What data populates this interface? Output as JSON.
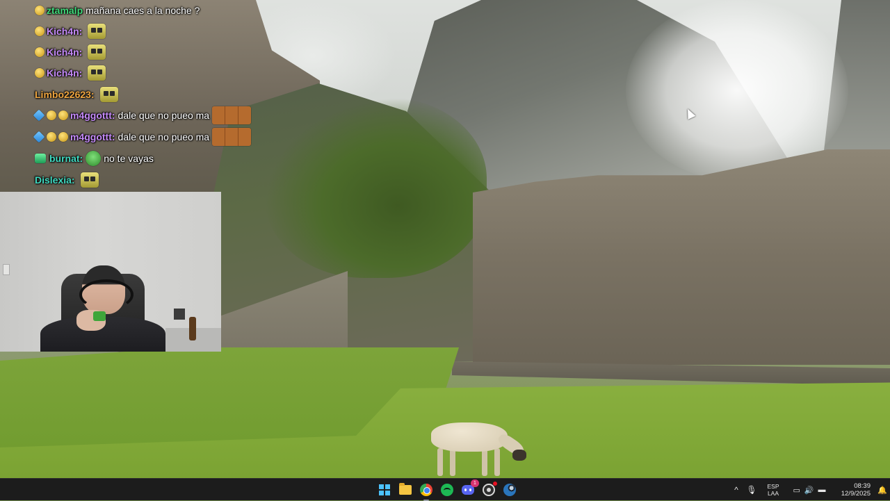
{
  "chat": {
    "messages": [
      {
        "user": "ztamalp",
        "text": "mañana caes a la noche ?",
        "user_color": "#3fd97a"
      },
      {
        "user": "Kich4n:",
        "text": "",
        "user_color": "#c58af9"
      },
      {
        "user": "Kich4n:",
        "text": "",
        "user_color": "#c58af9"
      },
      {
        "user": "Kich4n:",
        "text": "",
        "user_color": "#c58af9"
      },
      {
        "user": "Limbo22623:",
        "text": "",
        "user_color": "#f0a640"
      },
      {
        "user": "m4ggottt:",
        "text": "dale que no pueo ma",
        "user_color": "#c58af9"
      },
      {
        "user": "m4ggottt:",
        "text": "dale que no pueo ma",
        "user_color": "#c58af9"
      },
      {
        "user": "burnat:",
        "text": "no te vayas",
        "user_color": "#3fd9c0"
      },
      {
        "user": "Dislexia:",
        "text": "",
        "user_color": "#3fd9c0"
      }
    ]
  },
  "icons": {
    "badge": "sub-badge-icon",
    "emote": "emote-icon",
    "cursor": "mouse-cursor-icon"
  },
  "taskbar": {
    "apps": [
      "start-icon",
      "file-explorer-icon",
      "chrome-icon",
      "spotify-icon",
      "discord-icon",
      "obs-icon",
      "steam-icon"
    ],
    "discord_badge": "1",
    "tray": {
      "chevron": "^",
      "lang_line1": "ESP",
      "lang_line2": "LAA",
      "time": "08:39",
      "date": "12/9/2025"
    }
  },
  "colors": {
    "taskbar_bg": "#1c1c1c",
    "accent": "#4cc2ff"
  }
}
